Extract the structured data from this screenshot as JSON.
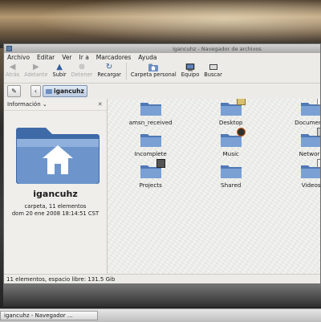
{
  "window": {
    "title": "igancuhz - Navegador de archivos"
  },
  "menubar": [
    "Archivo",
    "Editar",
    "Ver",
    "Ir a",
    "Marcadores",
    "Ayuda"
  ],
  "toolbar": {
    "back": "Atrás",
    "forward": "Adelante",
    "up": "Subir",
    "stop": "Detener",
    "reload": "Recargar",
    "home": "Carpeta personal",
    "computer": "Equipo",
    "search": "Buscar"
  },
  "location": {
    "current_folder": "igancuhz"
  },
  "sidebar": {
    "selector_label": "Información",
    "folder_name": "igancuhz",
    "folder_kind": "carpeta, 11 elementos",
    "modified": "dom 20 ene 2008 18:14:51 CST"
  },
  "files": [
    {
      "name": "amsn_received",
      "emblem": ""
    },
    {
      "name": "Desktop",
      "emblem": "desktop-emblem-icon"
    },
    {
      "name": "Documents",
      "emblem": "document-emblem-icon"
    },
    {
      "name": "Incomplete",
      "emblem": ""
    },
    {
      "name": "Music",
      "emblem": "music-emblem-icon"
    },
    {
      "name": "Network",
      "emblem": "network-emblem-icon"
    },
    {
      "name": "Projects",
      "emblem": "calculator-emblem-icon"
    },
    {
      "name": "Shared",
      "emblem": ""
    },
    {
      "name": "Videos",
      "emblem": "video-emblem-icon"
    }
  ],
  "statusbar": {
    "text": "11 elementos, espacio libre: 131.5 Gib"
  },
  "taskbar": {
    "task_label": "igancuhz - Navegador ..."
  },
  "colors": {
    "folder_blue": "#5d86bf",
    "folder_light": "#8fb0dc",
    "selection_blue": "#c1d0e6"
  }
}
